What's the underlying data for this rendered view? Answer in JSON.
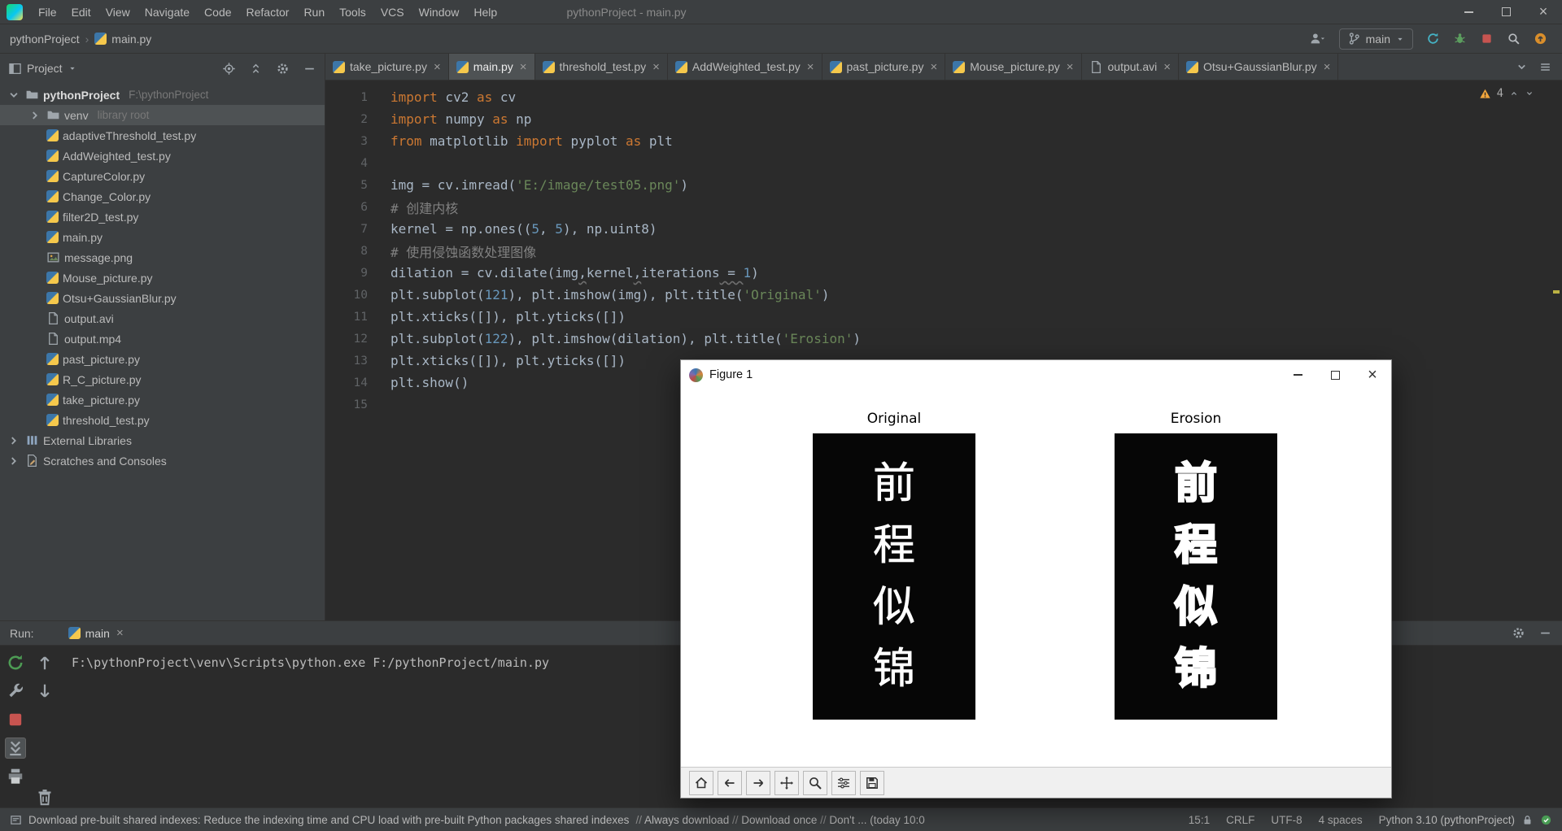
{
  "colors": {
    "editor_bg": "#2B2B2B",
    "panel_bg": "#3C3F41",
    "keyword": "#CC7832",
    "string": "#6A8759",
    "number": "#6897BB",
    "comment": "#808080",
    "warning": "#F2A63C",
    "run_green": "#499C54",
    "stop_red": "#C75450"
  },
  "title_bar": {
    "menus": [
      "File",
      "Edit",
      "View",
      "Navigate",
      "Code",
      "Refactor",
      "Run",
      "Tools",
      "VCS",
      "Window",
      "Help"
    ],
    "title": "pythonProject - main.py"
  },
  "nav_bar": {
    "breadcrumbs": [
      "pythonProject",
      "main.py"
    ],
    "branch_label": "main"
  },
  "project_panel": {
    "title": "Project",
    "tree": [
      {
        "label": "pythonProject",
        "hint": "F:\\pythonProject",
        "icon": "folder",
        "chev": "down",
        "indent": 0,
        "bold": true
      },
      {
        "label": "venv",
        "hint": "library root",
        "icon": "folder",
        "chev": "right",
        "indent": 1,
        "selected": true
      },
      {
        "label": "adaptiveThreshold_test.py",
        "icon": "py",
        "indent": 1
      },
      {
        "label": "AddWeighted_test.py",
        "icon": "py",
        "indent": 1
      },
      {
        "label": "CaptureColor.py",
        "icon": "py",
        "indent": 1
      },
      {
        "label": "Change_Color.py",
        "icon": "py",
        "indent": 1
      },
      {
        "label": "filter2D_test.py",
        "icon": "py",
        "indent": 1
      },
      {
        "label": "main.py",
        "icon": "py",
        "indent": 1
      },
      {
        "label": "message.png",
        "icon": "img",
        "indent": 1
      },
      {
        "label": "Mouse_picture.py",
        "icon": "py",
        "indent": 1
      },
      {
        "label": "Otsu+GaussianBlur.py",
        "icon": "py",
        "indent": 1
      },
      {
        "label": "output.avi",
        "icon": "file",
        "indent": 1
      },
      {
        "label": "output.mp4",
        "icon": "file",
        "indent": 1
      },
      {
        "label": "past_picture.py",
        "icon": "py",
        "indent": 1
      },
      {
        "label": "R_C_picture.py",
        "icon": "py",
        "indent": 1
      },
      {
        "label": "take_picture.py",
        "icon": "py",
        "indent": 1
      },
      {
        "label": "threshold_test.py",
        "icon": "py",
        "indent": 1
      },
      {
        "label": "External Libraries",
        "icon": "lib",
        "chev": "right",
        "indent": 0
      },
      {
        "label": "Scratches and Consoles",
        "icon": "scratch",
        "chev": "right",
        "indent": 0
      }
    ]
  },
  "editor": {
    "tabs": [
      {
        "label": "take_picture.py",
        "icon": "py",
        "active": false
      },
      {
        "label": "main.py",
        "icon": "py",
        "active": true
      },
      {
        "label": "threshold_test.py",
        "icon": "py",
        "active": false
      },
      {
        "label": "AddWeighted_test.py",
        "icon": "py",
        "active": false
      },
      {
        "label": "past_picture.py",
        "icon": "py",
        "active": false
      },
      {
        "label": "Mouse_picture.py",
        "icon": "py",
        "active": false
      },
      {
        "label": "output.avi",
        "icon": "file",
        "active": false
      },
      {
        "label": "Otsu+GaussianBlur.py",
        "icon": "py",
        "active": false
      }
    ],
    "warning_count": "4",
    "lines": [
      {
        "n": "1",
        "t": [
          [
            "kw",
            "import"
          ],
          [
            "pl",
            " cv2 "
          ],
          [
            "kw",
            "as"
          ],
          [
            "pl",
            " cv"
          ]
        ]
      },
      {
        "n": "2",
        "t": [
          [
            "kw",
            "import"
          ],
          [
            "pl",
            " numpy "
          ],
          [
            "kw",
            "as"
          ],
          [
            "pl",
            " np"
          ]
        ]
      },
      {
        "n": "3",
        "t": [
          [
            "kw",
            "from"
          ],
          [
            "pl",
            " matplotlib "
          ],
          [
            "kw",
            "import"
          ],
          [
            "pl",
            " pyplot "
          ],
          [
            "kw",
            "as"
          ],
          [
            "pl",
            " plt"
          ]
        ]
      },
      {
        "n": "4",
        "t": []
      },
      {
        "n": "5",
        "t": [
          [
            "pl",
            "img = cv.imread("
          ],
          [
            "str",
            "'E:/image/test05.png'"
          ],
          [
            "pl",
            ")"
          ]
        ]
      },
      {
        "n": "6",
        "t": [
          [
            "cmt",
            "# 创建内核"
          ]
        ]
      },
      {
        "n": "7",
        "t": [
          [
            "pl",
            "kernel = np.ones(("
          ],
          [
            "num",
            "5"
          ],
          [
            "pl",
            ", "
          ],
          [
            "num",
            "5"
          ],
          [
            "pl",
            "), np.uint8)"
          ]
        ]
      },
      {
        "n": "8",
        "t": [
          [
            "cmt",
            "# 使用侵蚀函数处理图像"
          ]
        ]
      },
      {
        "n": "9",
        "t": [
          [
            "pl",
            "dilation = cv.dilate(img"
          ],
          [
            "plw",
            ","
          ],
          [
            "pl",
            "kernel"
          ],
          [
            "plw",
            ","
          ],
          [
            "pl",
            "iterations"
          ],
          [
            "plw",
            " = "
          ],
          [
            "num",
            "1"
          ],
          [
            "pl",
            ")"
          ]
        ]
      },
      {
        "n": "10",
        "t": [
          [
            "pl",
            "plt.subplot("
          ],
          [
            "num",
            "121"
          ],
          [
            "pl",
            "), plt.imshow(img), plt.title("
          ],
          [
            "str",
            "'Original'"
          ],
          [
            "pl",
            ")"
          ]
        ]
      },
      {
        "n": "11",
        "t": [
          [
            "pl",
            "plt.xticks([]), plt.yticks([])"
          ]
        ]
      },
      {
        "n": "12",
        "t": [
          [
            "pl",
            "plt.subplot("
          ],
          [
            "num",
            "122"
          ],
          [
            "pl",
            "), plt.imshow(dilation), plt.title("
          ],
          [
            "str",
            "'Erosion'"
          ],
          [
            "pl",
            ")"
          ]
        ]
      },
      {
        "n": "13",
        "t": [
          [
            "pl",
            "plt.xticks([]), plt.yticks([])"
          ]
        ]
      },
      {
        "n": "14",
        "t": [
          [
            "pl",
            "plt.show()"
          ]
        ]
      },
      {
        "n": "15",
        "t": []
      }
    ]
  },
  "figure_window": {
    "title": "Figure 1",
    "subplot_titles": [
      "Original",
      "Erosion"
    ],
    "image_chars": [
      "前",
      "程",
      "似",
      "锦"
    ]
  },
  "run_panel": {
    "label": "Run:",
    "tab_label": "main",
    "console_line": "F:\\pythonProject\\venv\\Scripts\\python.exe F:/pythonProject/main.py"
  },
  "status_bar": {
    "message": "Download pre-built shared indexes: Reduce the indexing time and CPU load with pre-built Python packages shared indexes",
    "actions": [
      "Always download",
      "Download once",
      "Don't ..."
    ],
    "suffix": "(today 10:0",
    "items": [
      "15:1",
      "CRLF",
      "UTF-8",
      "4 spaces",
      "Python 3.10 (pythonProject)"
    ]
  },
  "icons": {
    "nav_right": [
      "code-with-me",
      "git-branch",
      "update-project",
      "debug",
      "stop",
      "search",
      "updates-available"
    ],
    "project_header": [
      "locate-file",
      "collapse-all",
      "settings-gear",
      "hide-panel"
    ],
    "run_toolbar": [
      "rerun",
      "wrench",
      "stop",
      "scroll-end",
      "printer"
    ],
    "console_toolbar": [
      "up-stack",
      "down-stack",
      "trash"
    ],
    "figure_toolbar": [
      "home",
      "back",
      "forward",
      "pan",
      "zoom",
      "configure",
      "save"
    ],
    "status_icons": [
      "lock",
      "no-problems"
    ]
  }
}
